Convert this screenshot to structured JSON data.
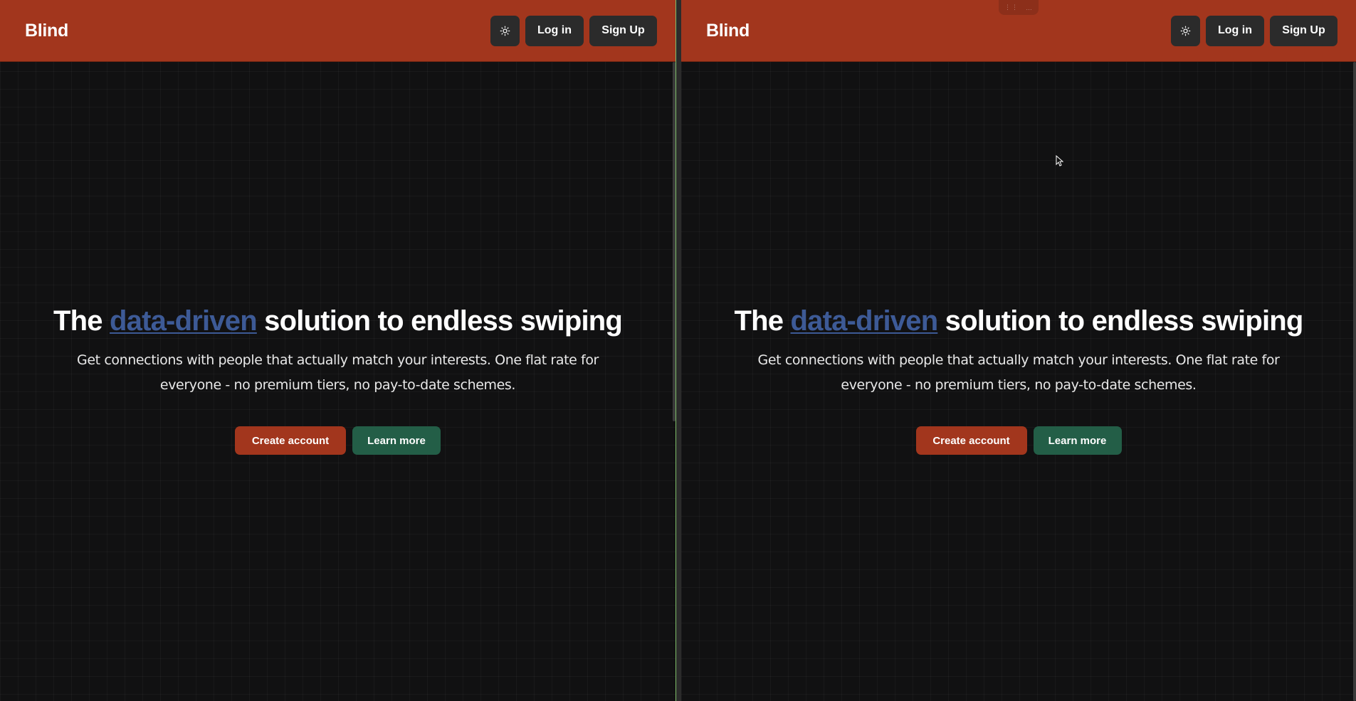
{
  "panes": [
    {
      "navbar": {
        "brand": "Blind",
        "theme_toggle_icon": "sun-icon",
        "login_label": "Log in",
        "signup_label": "Sign Up"
      },
      "hero": {
        "headline_prefix": "The",
        "headline_highlight": "data-driven",
        "headline_suffix": "solution to endless swiping",
        "subtitle": "Get connections with people that actually match your interests. One flat rate for everyone - no premium tiers, no pay-to-date schemes.",
        "primary_cta": "Create account",
        "secondary_cta": "Learn more"
      }
    },
    {
      "navbar": {
        "brand": "Blind",
        "theme_toggle_icon": "sun-icon",
        "login_label": "Log in",
        "signup_label": "Sign Up"
      },
      "hero": {
        "headline_prefix": "The",
        "headline_highlight": "data-driven",
        "headline_suffix": "solution to endless swiping",
        "subtitle": "Get connections with people that actually match your interests. One flat rate for everyone - no premium tiers, no pay-to-date schemes.",
        "primary_cta": "Create account",
        "secondary_cta": "Learn more"
      }
    }
  ],
  "colors": {
    "navbar_bg": "#a2361d",
    "page_bg": "#111112",
    "button_dark": "#2b2b2b",
    "highlight_text": "#3d5a96",
    "primary_cta_bg": "#a2361d",
    "secondary_cta_bg": "#235e47"
  }
}
